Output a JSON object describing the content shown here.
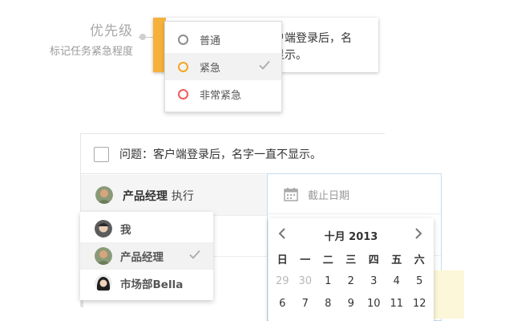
{
  "priority_annotation": {
    "title": "优先级",
    "subtitle": "标记任务紧急程度"
  },
  "top_task": {
    "text": "户端登录后，名\n显示。"
  },
  "priority_menu": {
    "items": [
      {
        "label": "普通",
        "ring_color": "#8e8e8e",
        "selected": false
      },
      {
        "label": "紧急",
        "ring_color": "#f5a623",
        "selected": true
      },
      {
        "label": "非常紧急",
        "ring_color": "#ef5b5b",
        "selected": false
      }
    ]
  },
  "task": {
    "text": "问题：客户端登录后，名字一直不显示。",
    "checked": false
  },
  "executor": {
    "name": "产品经理",
    "verb": "执行"
  },
  "assignee_menu": {
    "items": [
      {
        "label": "我",
        "selected": false
      },
      {
        "label": "产品经理",
        "selected": true
      },
      {
        "label": "市场部Bella",
        "selected": false
      }
    ]
  },
  "deadline": {
    "placeholder": "截止日期"
  },
  "datepicker": {
    "month_title": "十月 2013",
    "weekdays": [
      "日",
      "一",
      "二",
      "三",
      "四",
      "五",
      "六"
    ],
    "week1": [
      "29",
      "30",
      "1",
      "2",
      "3",
      "4",
      "5"
    ],
    "week2": [
      "6",
      "7",
      "8",
      "9",
      "10",
      "11",
      "12"
    ]
  },
  "colors": {
    "priority_strip": "#f6b13c",
    "accent_border": "#c6dcef"
  }
}
